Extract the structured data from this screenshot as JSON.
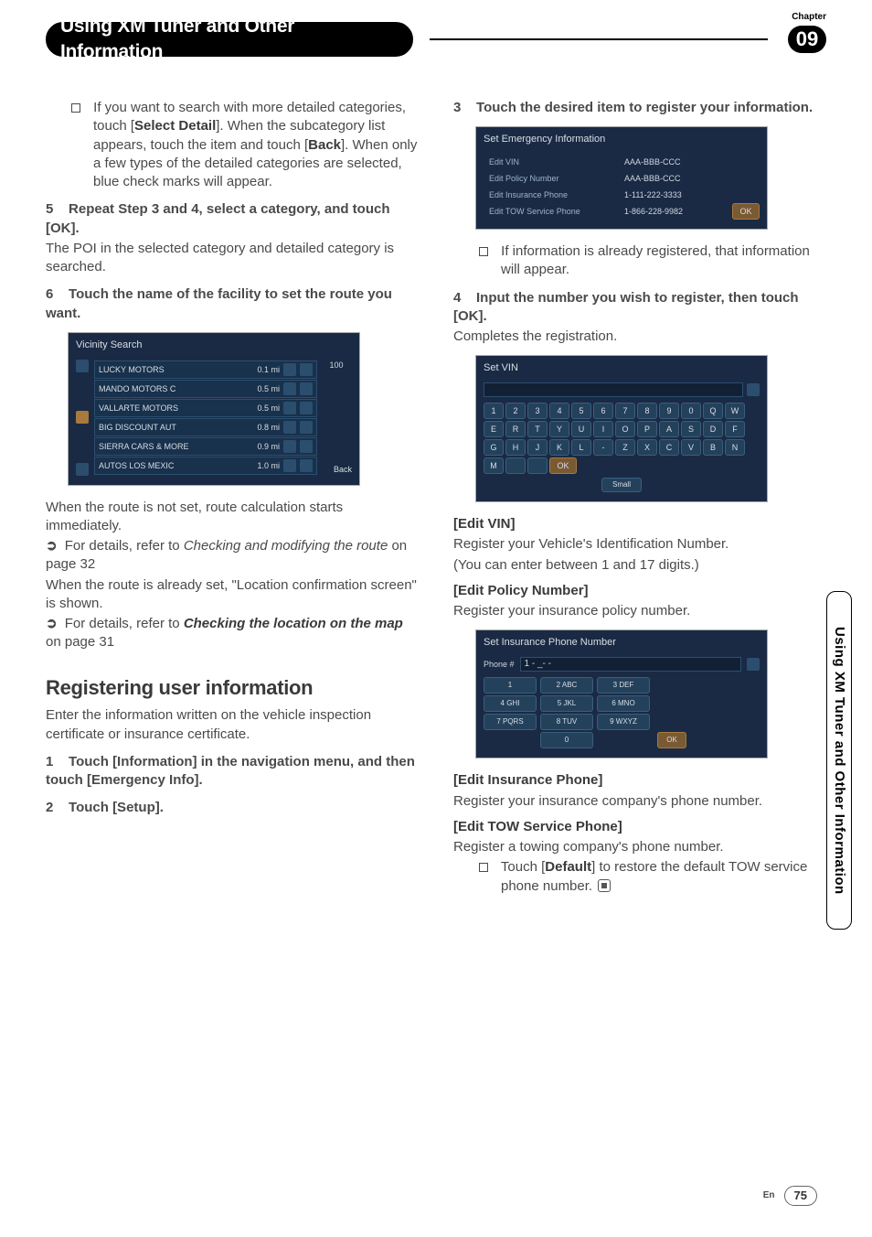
{
  "header": {
    "chapter_label": "Chapter",
    "chapter_number": "09",
    "title": "Using XM Tuner and Other Information"
  },
  "side_tab": "Using XM Tuner and Other Information",
  "footer": {
    "lang": "En",
    "page": "75"
  },
  "left": {
    "bullet1_a": "If you want to search with more detailed categories, touch [",
    "bullet1_b": "Select Detail",
    "bullet1_c": "]. When the subcategory list appears, touch the item and touch [",
    "bullet1_d": "Back",
    "bullet1_e": "]. When only a few types of the detailed categories are selected, blue check marks will appear.",
    "step5_num": "5",
    "step5_title": "Repeat Step 3 and 4, select a category, and touch [OK].",
    "step5_text": "The POI in the selected category and detailed category is searched.",
    "step6_num": "6",
    "step6_title": "Touch the name of the facility to set the route you want.",
    "vicinity": {
      "title": "Vicinity Search",
      "count": "100",
      "back": "Back",
      "rows": [
        {
          "name": "LUCKY MOTORS",
          "dist": "0.1 mi"
        },
        {
          "name": "MANDO MOTORS C",
          "dist": "0.5 mi"
        },
        {
          "name": "VALLARTE MOTORS",
          "dist": "0.5 mi"
        },
        {
          "name": "BIG DISCOUNT AUT",
          "dist": "0.8 mi"
        },
        {
          "name": "SIERRA CARS & MORE",
          "dist": "0.9 mi"
        },
        {
          "name": "AUTOS LOS MEXIC",
          "dist": "1.0 mi"
        }
      ]
    },
    "after_vic_1": "When the route is not set, route calculation starts immediately.",
    "ref1_a": "For details, refer to ",
    "ref1_i": "Checking and modifying the route",
    "ref1_b": " on page 32",
    "after_vic_2": "When the route is already set, \"Location confirmation screen\" is shown.",
    "ref2_a": "For details, refer to ",
    "ref2_b": "Checking the location on the map",
    "ref2_c": " on page 31",
    "h2": "Registering user information",
    "h2_text": "Enter the information written on the vehicle inspection certificate or insurance certificate.",
    "step1_num": "1",
    "step1_title": "Touch [Information] in the navigation menu, and then touch [Emergency Info].",
    "step2_num": "2",
    "step2_title": "Touch [Setup]."
  },
  "right": {
    "step3_num": "3",
    "step3_title": "Touch the desired item to register your information.",
    "emg": {
      "title": "Set Emergency Information",
      "ok": "OK",
      "rows": [
        {
          "lbl": "Edit VIN",
          "val": "AAA-BBB-CCC"
        },
        {
          "lbl": "Edit Policy Number",
          "val": "AAA-BBB-CCC"
        },
        {
          "lbl": "Edit Insurance Phone",
          "val": "1-111-222-3333"
        },
        {
          "lbl": "Edit TOW Service Phone",
          "val": "1-866-228-9982"
        }
      ]
    },
    "bullet2": "If information is already registered, that information will appear.",
    "step4_num": "4",
    "step4_title": "Input the number you wish to register, then touch [OK].",
    "step4_text": "Completes the registration.",
    "setvin": {
      "title": "Set VIN",
      "keys_r1": [
        "1",
        "2",
        "3",
        "4",
        "5",
        "6",
        "7",
        "8",
        "9",
        "0"
      ],
      "keys_r2": [
        "Q",
        "W",
        "E",
        "R",
        "T",
        "Y",
        "U",
        "I",
        "O",
        "P"
      ],
      "keys_r3": [
        "A",
        "S",
        "D",
        "F",
        "G",
        "H",
        "J",
        "K",
        "L",
        "-"
      ],
      "keys_r4": [
        "Z",
        "X",
        "C",
        "V",
        "B",
        "N",
        "M",
        "",
        "",
        "OK"
      ],
      "small": "Small"
    },
    "lbl_vin": "Edit VIN",
    "txt_vin_a": "Register your Vehicle's Identification Number.",
    "txt_vin_b": "(You can enter between 1 and 17 digits.)",
    "lbl_policy": "Edit Policy Number",
    "txt_policy": "Register your insurance policy number.",
    "phone": {
      "title": "Set Insurance Phone Number",
      "label": "Phone #",
      "value": "1 - _- -",
      "ok": "OK",
      "rows": [
        [
          "1",
          "2 ABC",
          "3 DEF"
        ],
        [
          "4 GHI",
          "5 JKL",
          "6 MNO"
        ],
        [
          "7 PQRS",
          "8 TUV",
          "9 WXYZ"
        ],
        [
          "",
          "0",
          ""
        ]
      ]
    },
    "lbl_ins": "Edit Insurance Phone",
    "txt_ins": "Register your insurance company's phone number.",
    "lbl_tow": "Edit TOW Service Phone",
    "txt_tow": "Register a towing company's phone number.",
    "bullet3_a": "Touch [",
    "bullet3_b": "Default",
    "bullet3_c": "] to restore the default TOW service phone number."
  }
}
